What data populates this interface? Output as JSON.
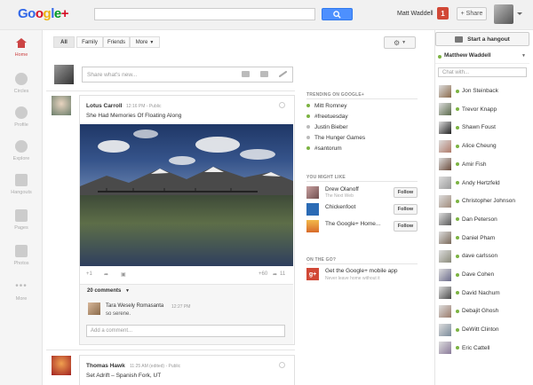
{
  "header": {
    "logo_parts": [
      "Go",
      "o",
      "g",
      "l",
      "e",
      "+"
    ],
    "user_name": "Matt Waddell",
    "notification_count": "1",
    "share_label": "+ Share"
  },
  "nav": [
    {
      "label": "Home"
    },
    {
      "label": "Circles"
    },
    {
      "label": "Profile"
    },
    {
      "label": "Explore"
    },
    {
      "label": "Hangouts"
    },
    {
      "label": "Pages"
    },
    {
      "label": "Photos"
    },
    {
      "label": "More"
    }
  ],
  "filters": {
    "all": "All",
    "family": "Family",
    "friends": "Friends",
    "more": "More"
  },
  "share_placeholder": "Share what's new...",
  "post1": {
    "author": "Lotus Carroll",
    "time": "12:16 PM - Public",
    "text": "She Had Memories Of Floating Along",
    "plus": "+1",
    "plus_count": "+60",
    "share_count": "11",
    "comments_label": "20 comments",
    "comment_author": "Tara Wesely Romasanta",
    "comment_time": "12:27 PM",
    "comment_text": "so serene.",
    "add_comment": "Add a comment..."
  },
  "post2": {
    "author": "Thomas Hawk",
    "time": "11:25 AM (edited) - Public",
    "text": "Set Adrift – Spanish Fork, UT"
  },
  "trending": {
    "title": "TRENDING ON GOOGLE+",
    "items": [
      "Mitt Romney",
      "#freetuesday",
      "Justin Bieber",
      "The Hunger Games",
      "#santorum"
    ]
  },
  "might_like": {
    "title": "YOU MIGHT LIKE",
    "items": [
      {
        "name": "Drew Olanoff",
        "sub": "The Next Web"
      },
      {
        "name": "Chickenfoot",
        "sub": ""
      },
      {
        "name": "The Google+ Home...",
        "sub": ""
      }
    ],
    "follow_label": "Follow"
  },
  "on_the_go": {
    "title": "ON THE GO?",
    "line1": "Get the Google+ mobile app",
    "line2": "Never leave home without it"
  },
  "chat": {
    "hangout_label": "Start a hangout",
    "header_name": "Matthew Waddell",
    "placeholder": "Chat with...",
    "contacts": [
      "Jon Steinback",
      "Trevor Knapp",
      "Shawn Foust",
      "Alice Cheung",
      "Amir Fish",
      "Andy Hertzfeld",
      "Christopher Johnson",
      "Dan Peterson",
      "Daniel Pham",
      "dave carlsson",
      "Dave Cohen",
      "David Nachum",
      "Debajit Ghosh",
      "DeWitt Clinton",
      "Eric Cattell"
    ]
  },
  "colors": {
    "accent": "#4d90fe",
    "notif": "#d14836",
    "online": "#7cb342"
  }
}
